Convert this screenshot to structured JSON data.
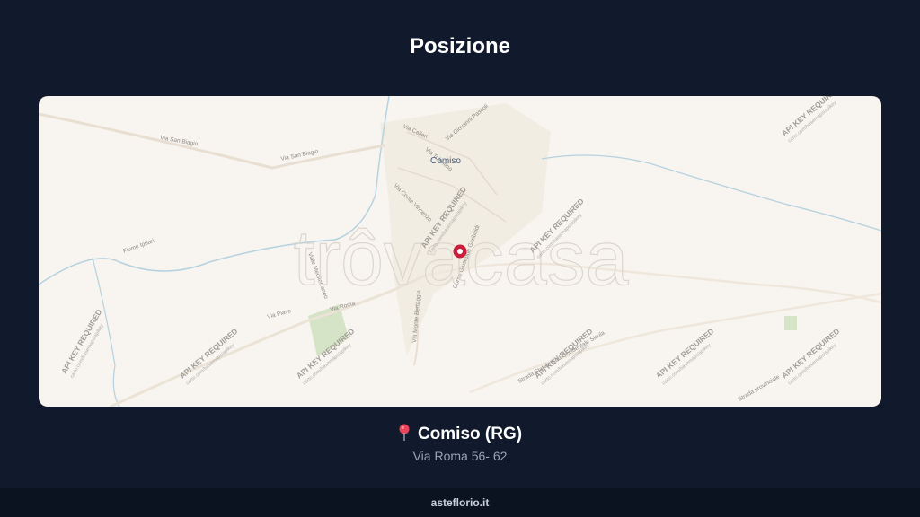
{
  "page": {
    "title": "Posizione"
  },
  "map": {
    "city_label": "Comiso",
    "watermark_text": "trôvacasa",
    "api_notice": "API KEY REQUIRED",
    "api_subnotice": "carto.com/basemaps/apikey",
    "streets": [
      "Via San Biagio",
      "Via San Biagio",
      "Via Calleri",
      "Via Giovanni Pascoli",
      "Via Conte Vincenzo",
      "Viale Mediterraneo",
      "Via Piave",
      "Via Roma",
      "Via Monte Bertaggia",
      "Corso Giuseppe Garibaldi",
      "Strada Statale Sud Occidentale Sicula",
      "Fiume Ippari",
      "Via Tolentino",
      "Strada provinciale"
    ],
    "colors": {
      "background": "#f8f4f0",
      "marker": "#c81e3c",
      "roads": "#e6ddd0",
      "water": "#a8c8d8",
      "park": "#cfe0c0"
    }
  },
  "location": {
    "city": "Comiso (RG)",
    "address": "Via Roma 56- 62",
    "pin": "map-pin-icon"
  },
  "footer": {
    "site": "asteflorio.it"
  }
}
